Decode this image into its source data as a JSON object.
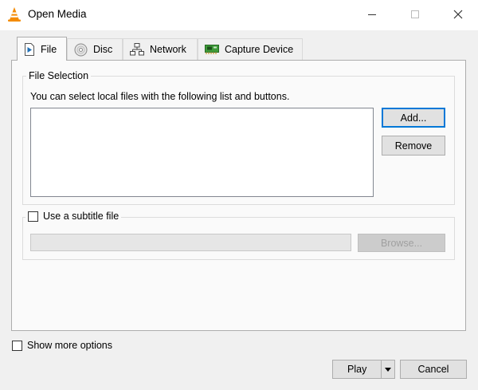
{
  "window": {
    "title": "Open Media",
    "icon": "vlc-cone-icon",
    "controls": {
      "minimize_icon": "minimize-icon",
      "maximize_icon": "maximize-icon",
      "close_icon": "close-icon"
    }
  },
  "tabs": [
    {
      "label": "File",
      "icon": "file-play-icon",
      "active": true
    },
    {
      "label": "Disc",
      "icon": "disc-icon",
      "active": false
    },
    {
      "label": "Network",
      "icon": "network-icon",
      "active": false
    },
    {
      "label": "Capture Device",
      "icon": "capture-card-icon",
      "active": false
    }
  ],
  "file_selection": {
    "group_title": "File Selection",
    "description": "You can select local files with the following list and buttons.",
    "files": [],
    "add_button": "Add...",
    "remove_button": "Remove"
  },
  "subtitle": {
    "checkbox_label": "Use a subtitle file",
    "checked": false,
    "path_value": "",
    "browse_button": "Browse...",
    "enabled": false
  },
  "footer": {
    "show_more_label": "Show more options",
    "show_more_checked": false,
    "play_button": "Play",
    "play_dropdown_icon": "caret-down-icon",
    "cancel_button": "Cancel"
  },
  "colors": {
    "accent": "#0078d7",
    "window_bg": "#f0f0f0",
    "panel_bg": "#fafafa",
    "vlc_orange": "#f48b00"
  }
}
